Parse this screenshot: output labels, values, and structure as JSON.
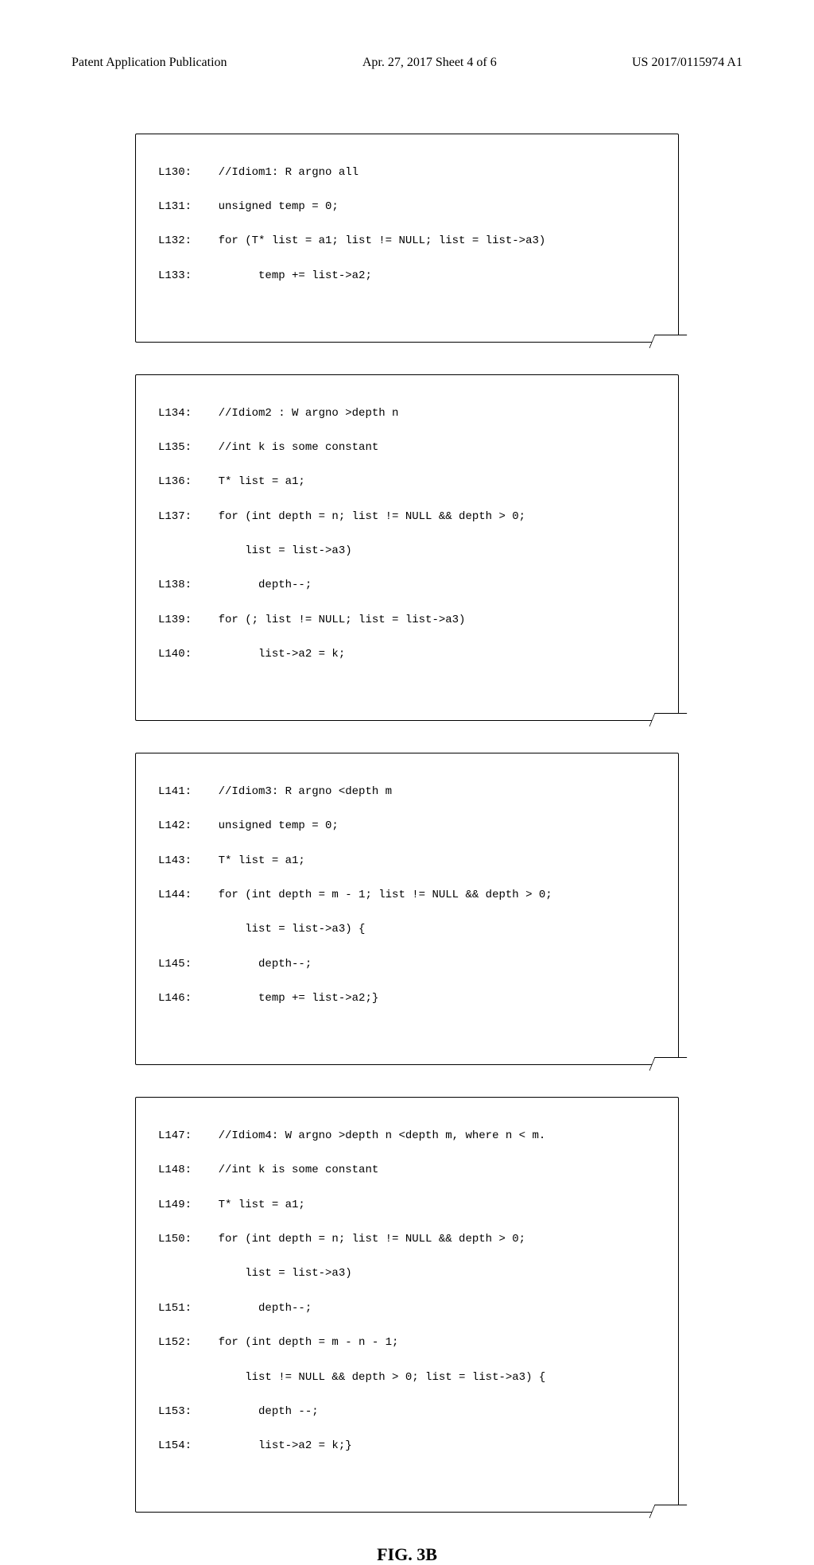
{
  "header": {
    "left": "Patent Application Publication",
    "center": "Apr. 27, 2017  Sheet 4 of 6",
    "right": "US 2017/0115974 A1"
  },
  "boxes": [
    {
      "lines": [
        "L130:    //Idiom1: R argno all",
        "L131:    unsigned temp = 0;",
        "L132:    for (T* list = a1; list != NULL; list = list->a3)",
        "L133:          temp += list->a2;"
      ]
    },
    {
      "lines": [
        "L134:    //Idiom2 : W argno >depth n",
        "L135:    //int k is some constant",
        "L136:    T* list = a1;",
        "L137:    for (int depth = n; list != NULL && depth > 0;",
        "             list = list->a3)",
        "L138:          depth--;",
        "L139:    for (; list != NULL; list = list->a3)",
        "L140:          list->a2 = k;"
      ]
    },
    {
      "lines": [
        "L141:    //Idiom3: R argno <depth m",
        "L142:    unsigned temp = 0;",
        "L143:    T* list = a1;",
        "L144:    for (int depth = m - 1; list != NULL && depth > 0;",
        "             list = list->a3) {",
        "L145:          depth--;",
        "L146:          temp += list->a2;}"
      ]
    },
    {
      "lines": [
        "L147:    //Idiom4: W argno >depth n <depth m, where n < m.",
        "L148:    //int k is some constant",
        "L149:    T* list = a1;",
        "L150:    for (int depth = n; list != NULL && depth > 0;",
        "             list = list->a3)",
        "L151:          depth--;",
        "L152:    for (int depth = m - n - 1;",
        "             list != NULL && depth > 0; list = list->a3) {",
        "L153:          depth --;",
        "L154:          list->a2 = k;}"
      ]
    }
  ],
  "figure_label": "FIG. 3B"
}
